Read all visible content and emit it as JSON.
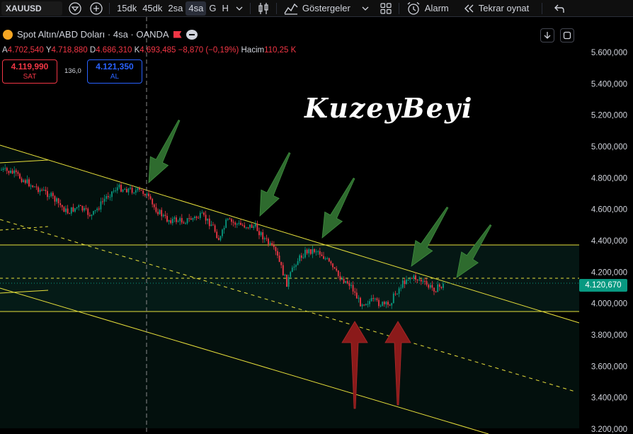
{
  "toolbar": {
    "symbol": "XAUUSD",
    "timeframes": [
      "15dk",
      "45dk",
      "2sa",
      "4sa",
      "G",
      "H"
    ],
    "active_timeframe": "4sa",
    "indicators_label": "Göstergeler",
    "alarm_label": "Alarm",
    "replay_label": "Tekrar oynat",
    "icons": [
      "brand-icon",
      "add-symbol-icon",
      "chevron-down-icon",
      "candle-type-icon",
      "indicators-icon",
      "layouts-icon",
      "alarm-icon",
      "replay-icon",
      "undo-icon"
    ]
  },
  "legend": {
    "title": "Spot Altın/ABD Doları · 4sa · OANDA",
    "open_label": "A",
    "open": "4.702,540",
    "high_label": "Y",
    "high": "4.718,880",
    "low_label": "D",
    "low": "4.686,310",
    "close_label": "K",
    "close": "4.693,485",
    "change": "−8,870 (−0,19%)",
    "volume_label": "Hacim",
    "volume": "110,25 K"
  },
  "trade": {
    "sell_price": "4.119,990",
    "sell_label": "SAT",
    "spread": "136,0",
    "buy_price": "4.121,350",
    "buy_label": "AL"
  },
  "watermark": "KuzeyBeyi",
  "price_axis": {
    "ticks": [
      "5.600,000",
      "5.400,000",
      "5.200,000",
      "5.000,000",
      "4.800,000",
      "4.600,000",
      "4.400,000",
      "4.200,000",
      "4.000,000",
      "3.800,000",
      "3.600,000",
      "3.400,000",
      "3.200,000"
    ],
    "current_price": "4.120,670"
  },
  "colors": {
    "up": "#089981",
    "down": "#f23645",
    "trendline": "#e8e03b",
    "green_arrow": "#2e6b2e",
    "red_arrow": "#8b1a1a",
    "background": "#000000"
  }
}
